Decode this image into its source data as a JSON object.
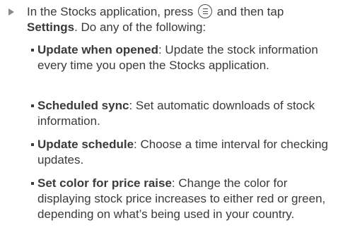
{
  "step": {
    "part1": "In the Stocks application, press",
    "part2": "and then tap",
    "settings": "Settings",
    "part3": ". Do any of the following:"
  },
  "options": [
    {
      "label": "Update when opened",
      "desc": ": Update the stock information every time you open the Stocks application."
    },
    {
      "label": "Scheduled sync",
      "desc": ": Set automatic downloads of stock information."
    },
    {
      "label": "Update schedule",
      "desc": ": Choose a time interval for checking updates."
    },
    {
      "label": "Set color for price raise",
      "desc": ": Change the color for displaying stock price increases to either red or green, depending on what’s being used in your country."
    }
  ],
  "icons": {
    "bullet_arrow": "arrow-right-icon",
    "menu_button": "menu-icon"
  }
}
